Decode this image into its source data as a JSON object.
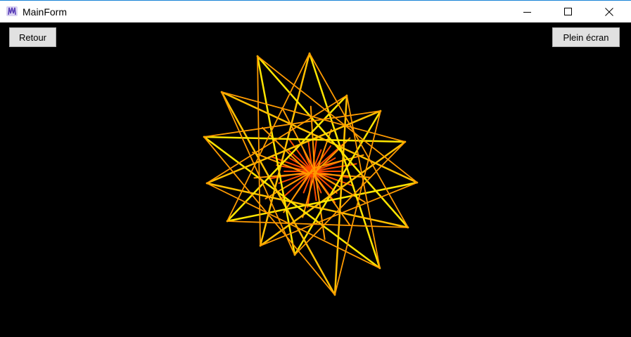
{
  "window": {
    "title": "MainForm",
    "controls": {
      "minimize_icon": "minimize-icon",
      "maximize_icon": "maximize-icon",
      "close_icon": "close-icon"
    }
  },
  "toolbar": {
    "back_label": "Retour",
    "fullscreen_label": "Plein écran"
  },
  "colors": {
    "background": "#000000",
    "ray_yellow": "#ffe600",
    "ray_gold": "#ffc000",
    "ray_orange": "#ff9a00",
    "ray_red": "#ff4a00"
  }
}
